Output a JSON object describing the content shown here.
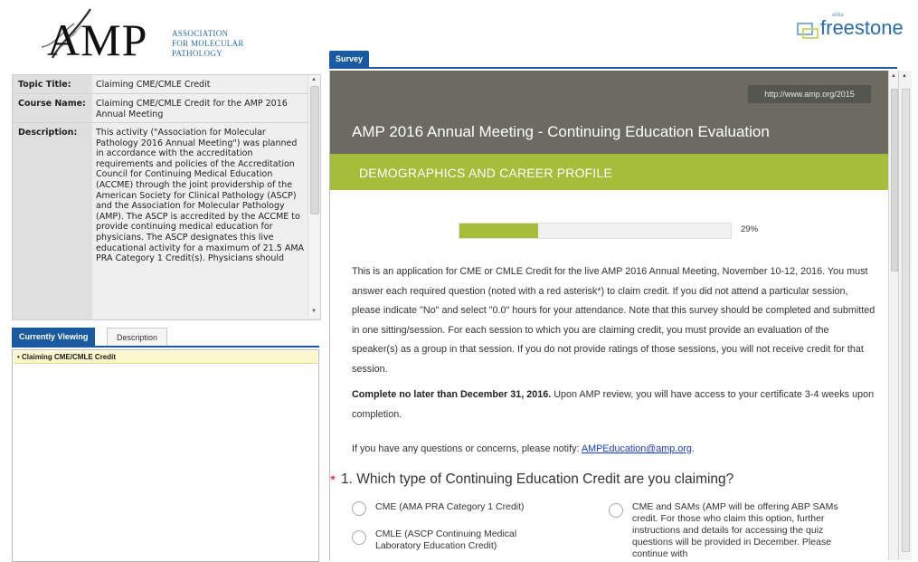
{
  "logo": {
    "brand": "AMP",
    "subtitle_line1": "ASSOCIATION",
    "subtitle_line2": "FOR MOLECULAR",
    "subtitle_line3": "PATHOLOGY"
  },
  "partner_logo": {
    "small": "ablia",
    "name": "freestone"
  },
  "course_info": {
    "rows": [
      {
        "label": "Topic Title:",
        "value": "Claiming CME/CMLE Credit"
      },
      {
        "label": "Course Name:",
        "value": "Claiming CME/CMLE Credit for the AMP 2016 Annual Meeting"
      },
      {
        "label": "Description:",
        "value": "This activity (\"Association for Molecular Pathology 2016 Annual Meeting\") was planned in accordance with the accreditation requirements and policies of the Accreditation Council for Continuing Medical Education (ACCME) through the joint providership of the American Society for Clinical Pathology (ASCP) and the Association for Molecular Pathology (AMP). The ASCP is accredited by the ACCME to provide continuing medical education for physicians. The ASCP designates this live educational activity for a maximum of 21.5 AMA PRA Category 1 Credit(s). Physicians should"
      }
    ]
  },
  "left_tabs": {
    "active": "Currently Viewing",
    "inactive": "Description"
  },
  "nav": {
    "current_item": "• Claiming CME/CMLE Credit"
  },
  "survey_tab": "Survey",
  "survey": {
    "url": "http://www.amp.org/2015",
    "title": "AMP 2016 Annual Meeting - Continuing Education Evaluation",
    "section": "DEMOGRAPHICS AND CAREER PROFILE",
    "progress": {
      "fraction": 0.29,
      "label": "29%"
    },
    "intro": "This is an application for CME or CMLE Credit for the live AMP 2016 Annual Meeting, November 10-12, 2016. You must answer each required question (noted with a red asterisk*) to claim credit. If you did not attend a particular session, please indicate \"No\" and select \"0.0\" hours for your attendance. Note that this survey should be completed and submitted in one sitting/session. For each session to which you are claiming credit, you must provide an evaluation of the speaker(s) as a group in that session. If you do not provide ratings of those sessions, you will not receive credit for that session.",
    "deadline_bold": "Complete no later than December 31, 2016.",
    "deadline_rest": " Upon AMP review, you will have access to your certificate 3-4 weeks upon completion.",
    "contact_prefix": "If you have any questions or concerns, please notify: ",
    "contact_email": "AMPEducation@amp.org",
    "contact_suffix": ".",
    "question1": {
      "required_marker": "*",
      "text": "1. Which type of Continuing Education Credit are you claiming?",
      "options": [
        "CME (AMA PRA Category 1 Credit)",
        "CMLE (ASCP Continuing Medical Laboratory Education Credit)",
        "CME and SAMs (AMP will be offering ABP SAMs credit. For those who claim this option, further instructions and details for accessing the quiz questions will be provided in December. Please continue with"
      ]
    }
  },
  "colors": {
    "header_gray": "#6b6b61",
    "accent_green": "#a4be3c",
    "tab_blue": "#1a5aa0",
    "required_red": "#d21f1f",
    "link_blue": "#1a3cc4"
  }
}
